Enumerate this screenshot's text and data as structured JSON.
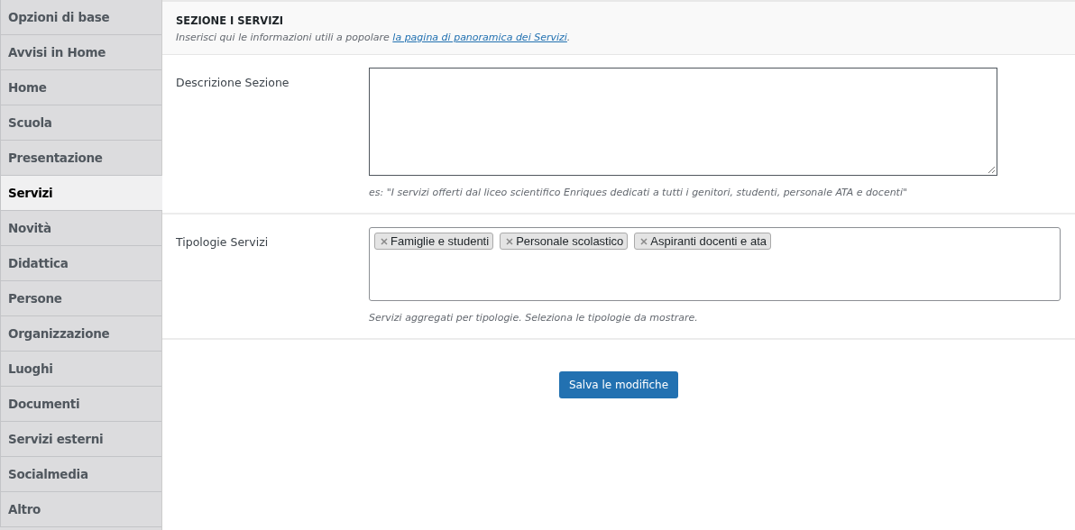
{
  "sidebar": {
    "items": [
      {
        "label": "Opzioni di base",
        "selected": false
      },
      {
        "label": "Avvisi in Home",
        "selected": false
      },
      {
        "label": "Home",
        "selected": false
      },
      {
        "label": "Scuola",
        "selected": false
      },
      {
        "label": "Presentazione",
        "selected": false
      },
      {
        "label": "Servizi",
        "selected": true
      },
      {
        "label": "Novità",
        "selected": false
      },
      {
        "label": "Didattica",
        "selected": false
      },
      {
        "label": "Persone",
        "selected": false
      },
      {
        "label": "Organizzazione",
        "selected": false
      },
      {
        "label": "Luoghi",
        "selected": false
      },
      {
        "label": "Documenti",
        "selected": false
      },
      {
        "label": "Servizi esterni",
        "selected": false
      },
      {
        "label": "Socialmedia",
        "selected": false
      },
      {
        "label": "Altro",
        "selected": false
      }
    ]
  },
  "section": {
    "title": "SEZIONE I SERVIZI",
    "intro": "Inserisci qui le informazioni utili a popolare ",
    "intro_link": "la pagina di panoramica dei Servizi",
    "intro_end": "."
  },
  "fields": [
    {
      "kind": "textarea",
      "label": "Descrizione Sezione",
      "help": "es: \"I servizi offerti dal liceo scientifico Enriques dedicati a tutti i genitori, studenti, personale ATA e docenti\""
    },
    {
      "kind": "tags",
      "label": "Tipologie Servizi",
      "tags": [
        "Famiglie e studenti",
        "Personale scolastico",
        "Aspiranti docenti e ata"
      ],
      "help": "Servizi aggregati per tipologie. Seleziona le tipologie da mostrare."
    }
  ],
  "save_button": "Salva le modifiche"
}
